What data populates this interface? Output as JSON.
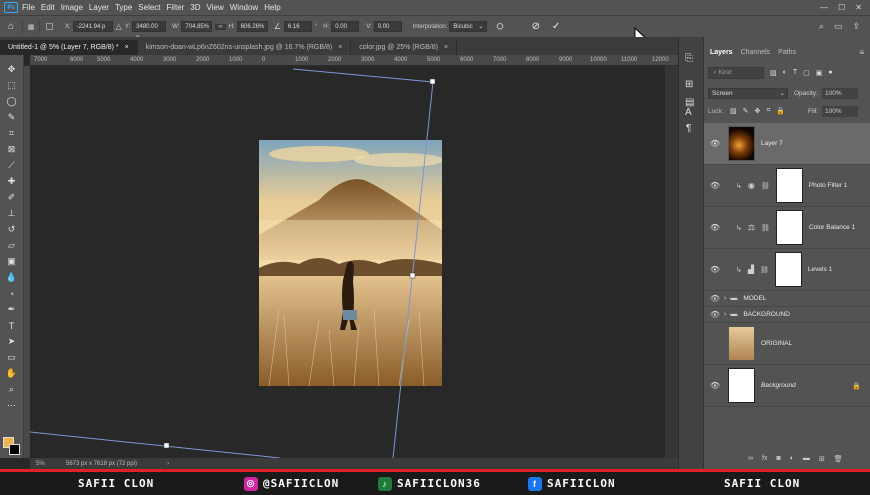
{
  "menu": {
    "items": [
      "File",
      "Edit",
      "Image",
      "Layer",
      "Type",
      "Select",
      "Filter",
      "3D",
      "View",
      "Window",
      "Help"
    ]
  },
  "options": {
    "x_label": "X:",
    "x_value": "-2241.94 p",
    "y_label": "Y:",
    "y_value": "3480.00 p",
    "w_label": "W:",
    "w_value": "704.85%",
    "h_label": "H:",
    "h_value": "606.26%",
    "angle_value": "6.16",
    "angle_unit": "°",
    "h2_label": "H:",
    "h2_value": "0.00",
    "v_label": "V:",
    "v_value": "0.00",
    "interp_label": "Interpolation:",
    "interp_value": "Bicubic"
  },
  "tabs": [
    {
      "label": "Untitled-1 @ 5% (Layer 7, RGB/8) *"
    },
    {
      "label": "kimson-doan-wLp6nZ602ns-unsplash.jpg @ 16.7% (RGB/8)"
    },
    {
      "label": "color.jpg @ 25% (RGB/8)"
    }
  ],
  "ruler": {
    "ticks": [
      "7000",
      "6000",
      "5000",
      "4000",
      "3000",
      "2000",
      "1000",
      "0",
      "1000",
      "2000",
      "3000",
      "4000",
      "5000",
      "6000",
      "7000",
      "8000",
      "9000",
      "10000",
      "11000",
      "12000"
    ]
  },
  "status": {
    "zoom": "5%",
    "doc_size": "5673 px x 7618 px (72 ppi)",
    "arrow": "›"
  },
  "panel": {
    "tabs": [
      "Layers",
      "Channels",
      "Paths"
    ],
    "search_placeholder": "Kind",
    "blend_mode": "Screen",
    "opacity_label": "Opacity:",
    "opacity_value": "100%",
    "lock_label": "Lock:",
    "fill_label": "Fill:",
    "fill_value": "100%",
    "layers": [
      {
        "name": "Layer 7"
      },
      {
        "name": "Photo Filter 1"
      },
      {
        "name": "Color Balance 1"
      },
      {
        "name": "Levels 1"
      },
      {
        "name": "MODEL"
      },
      {
        "name": "BACKGROUND"
      },
      {
        "name": "ORIGINAL"
      },
      {
        "name": "Background"
      }
    ]
  },
  "footer": {
    "left": "SAFII CLON",
    "ig": "@SAFIICLON",
    "tiktok": "SAFIICLON36",
    "fb": "SAFIICLON",
    "right": "SAFII CLON"
  },
  "colors": {
    "accent": "#31a8ff",
    "footer_red": "#e0202a",
    "fg_swatch": "#f2b24a",
    "bg_swatch": "#000000"
  }
}
